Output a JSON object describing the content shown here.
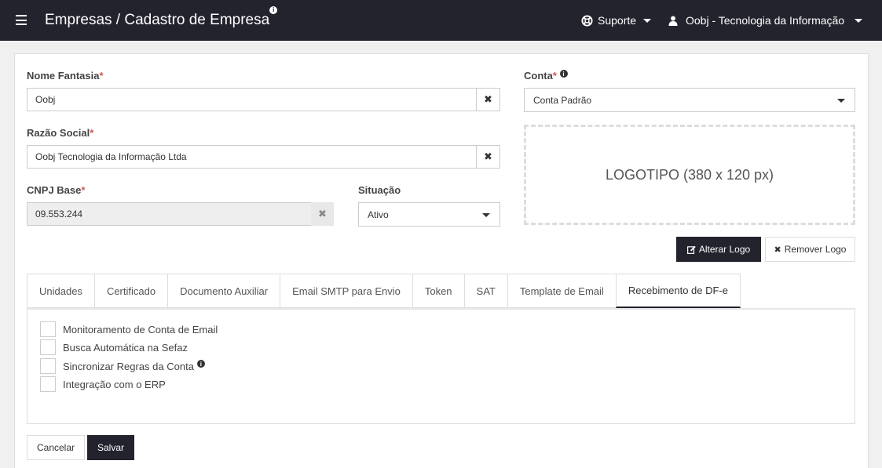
{
  "topbar": {
    "title": "Empresas / Cadastro de Empresa",
    "title_info_icon": "info-icon",
    "support_label": "Suporte",
    "user_label": "Oobj - Tecnologia da Informação"
  },
  "form": {
    "nome_fantasia": {
      "label": "Nome Fantasia",
      "required_mark": "*",
      "value": "Oobj"
    },
    "razao_social": {
      "label": "Razão Social",
      "required_mark": "*",
      "value": "Oobj Tecnologia da Informação Ltda"
    },
    "cnpj_base": {
      "label": "CNPJ Base",
      "required_mark": "*",
      "value": "09.553.244"
    },
    "situacao": {
      "label": "Situação",
      "value": "Ativo"
    },
    "conta": {
      "label": "Conta",
      "required_mark": "*",
      "value": "Conta Padrão"
    },
    "clear_symbol": "✖"
  },
  "logo": {
    "placeholder": "LOGOTIPO (380 x 120 px)",
    "change_label": "Alterar Logo",
    "remove_label": "Remover Logo"
  },
  "tabs": [
    {
      "label": "Unidades",
      "active": false
    },
    {
      "label": "Certificado",
      "active": false
    },
    {
      "label": "Documento Auxiliar",
      "active": false
    },
    {
      "label": "Email SMTP para Envio",
      "active": false
    },
    {
      "label": "Token",
      "active": false
    },
    {
      "label": "SAT",
      "active": false
    },
    {
      "label": "Template de Email",
      "active": false
    },
    {
      "label": "Recebimento de DF-e",
      "active": true
    }
  ],
  "options": [
    {
      "label": "Monitoramento de Conta de Email",
      "checked": false
    },
    {
      "label": "Busca Automática na Sefaz",
      "checked": false
    },
    {
      "label": "Sincronizar Regras da Conta",
      "checked": false,
      "info": true
    },
    {
      "label": "Integração com o ERP",
      "checked": false
    }
  ],
  "actions": {
    "cancel_label": "Cancelar",
    "save_label": "Salvar"
  },
  "colors": {
    "topbar": "#23232e",
    "required": "#d9534f",
    "primary_button": "#23232e"
  }
}
